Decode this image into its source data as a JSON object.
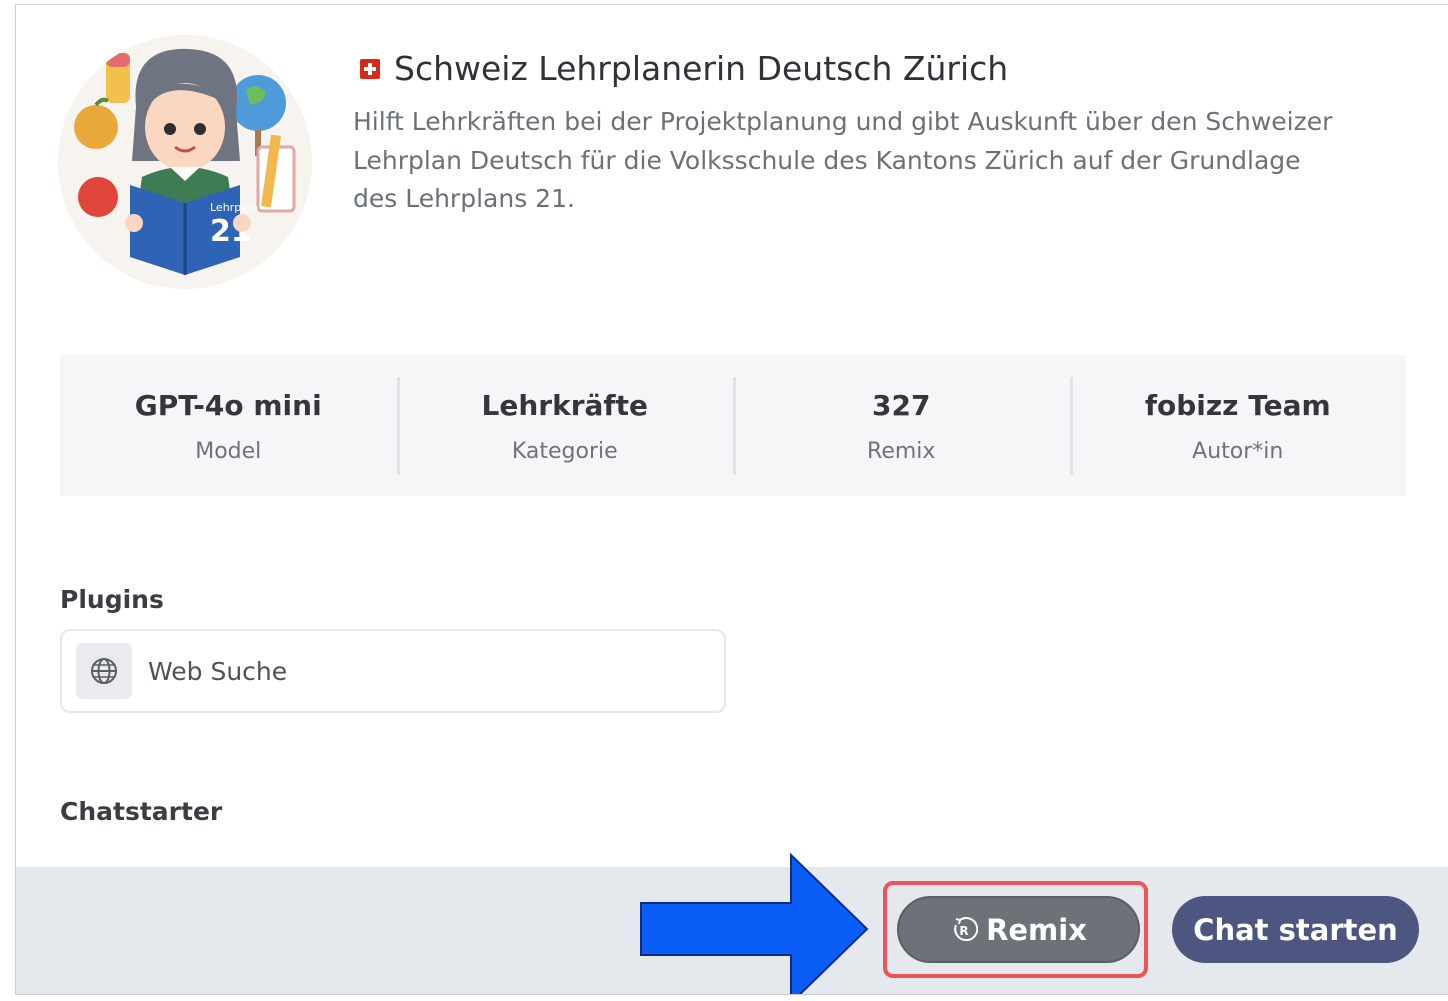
{
  "gpt": {
    "title": "Schweiz Lehrplanerin Deutsch Zürich",
    "description": "Hilft Lehrkräften bei der Projektplanung und gibt Auskunft über den Schweizer Lehrplan Deutsch für die Volksschule des Kantons Zürich auf der Grundlage des Lehrplans 21.",
    "flag_icon": "swiss-flag-icon",
    "avatar_book_label": "Lehrplan",
    "avatar_book_number": "21"
  },
  "stats": [
    {
      "value": "GPT-4o mini",
      "label": "Model"
    },
    {
      "value": "Lehrkräfte",
      "label": "Kategorie"
    },
    {
      "value": "327",
      "label": "Remix"
    },
    {
      "value": "fobizz Team",
      "label": "Autor*in"
    }
  ],
  "plugins": {
    "heading": "Plugins",
    "items": [
      {
        "label": "Web Suche",
        "icon": "globe-icon"
      }
    ]
  },
  "chatstarter": {
    "heading": "Chatstarter"
  },
  "footer": {
    "remix_label": "Remix",
    "chat_label": "Chat starten"
  },
  "colors": {
    "highlight": "#f0525a",
    "arrow": "#0a5ef5",
    "chat_button": "#4d5581",
    "remix_button": "#6d7278"
  }
}
